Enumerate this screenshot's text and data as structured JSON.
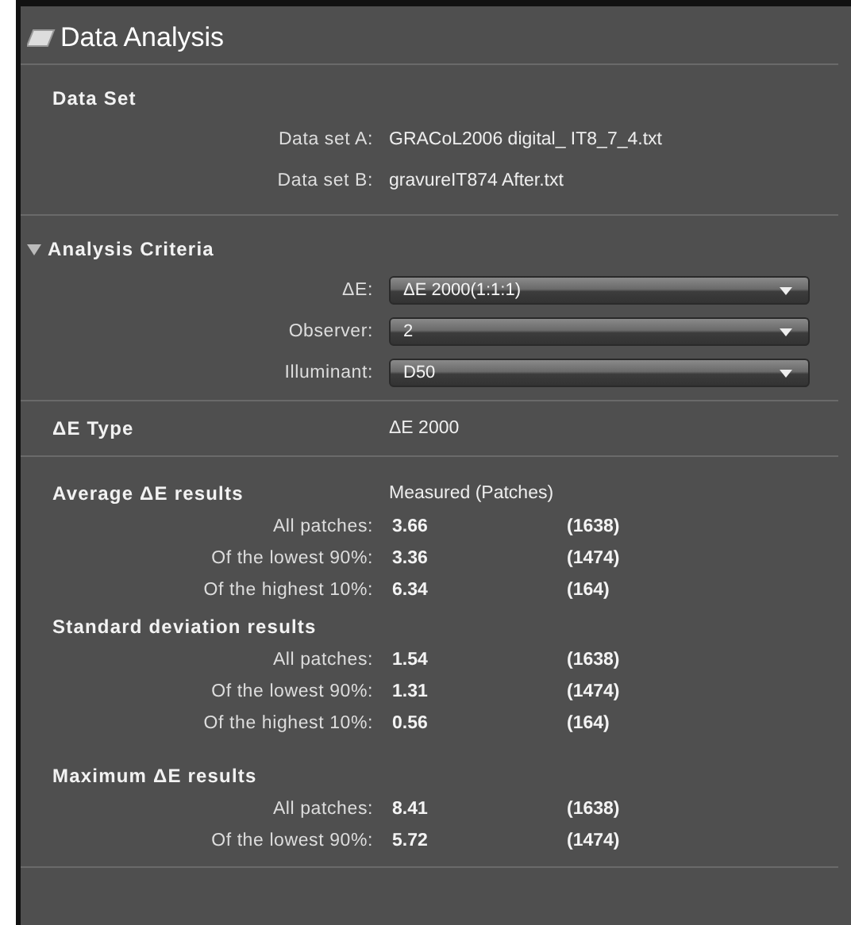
{
  "panel": {
    "title": "Data Analysis"
  },
  "data_set": {
    "title": "Data Set",
    "rows": [
      {
        "label": "Data set A:",
        "value": "GRACoL2006 digital_ IT8_7_4.txt"
      },
      {
        "label": "Data set B:",
        "value": "gravureIT874 After.txt"
      }
    ]
  },
  "analysis_criteria": {
    "title": "Analysis Criteria",
    "expanded": true,
    "fields": [
      {
        "label": "ΔE:",
        "value": "ΔE 2000(1:1:1)"
      },
      {
        "label": "Observer:",
        "value": "2"
      },
      {
        "label": "Illuminant:",
        "value": "D50"
      }
    ]
  },
  "de_type": {
    "label": "ΔE Type",
    "value": "ΔE 2000"
  },
  "results": [
    {
      "title": "Average ΔE results",
      "column_header": "Measured (Patches)",
      "rows": [
        {
          "label": "All patches:",
          "value": "3.66",
          "count": "(1638)"
        },
        {
          "label": "Of the lowest 90%:",
          "value": "3.36",
          "count": "(1474)"
        },
        {
          "label": "Of the highest 10%:",
          "value": "6.34",
          "count": "(164)"
        }
      ]
    },
    {
      "title": "Standard deviation results",
      "rows": [
        {
          "label": "All patches:",
          "value": "1.54",
          "count": "(1638)"
        },
        {
          "label": "Of the lowest 90%:",
          "value": "1.31",
          "count": "(1474)"
        },
        {
          "label": "Of the highest 10%:",
          "value": "0.56",
          "count": "(164)"
        }
      ]
    },
    {
      "title": "Maximum ΔE results",
      "rows": [
        {
          "label": "All patches:",
          "value": "8.41",
          "count": "(1638)"
        },
        {
          "label": "Of the lowest 90%:",
          "value": "5.72",
          "count": "(1474)"
        }
      ]
    }
  ]
}
